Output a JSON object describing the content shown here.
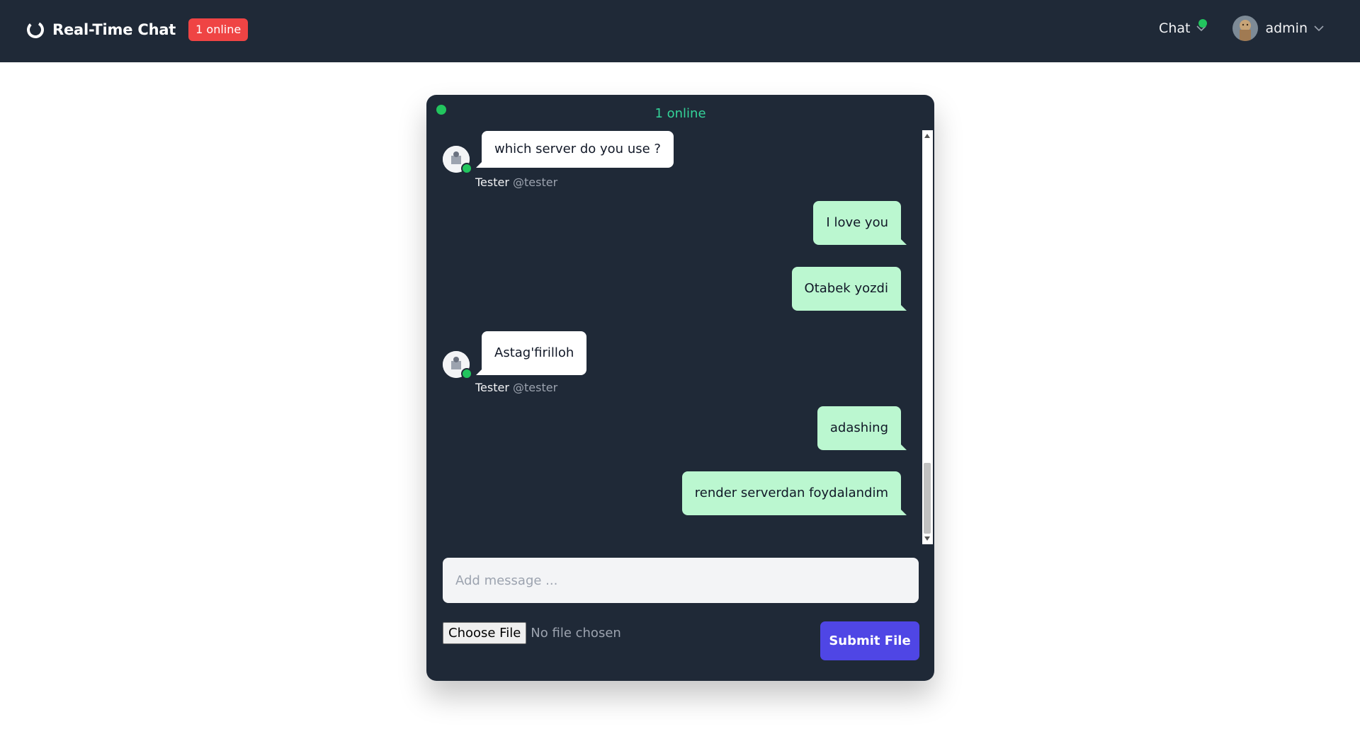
{
  "header": {
    "brand_title": "Real-Time Chat",
    "online_badge": "1 online",
    "nav_chat_label": "Chat",
    "user_name": "admin"
  },
  "chat": {
    "online_status": "1 online",
    "messages": [
      {
        "direction": "incoming",
        "text": "which server do you use ?",
        "author_name": "Tester",
        "author_handle": "@tester"
      },
      {
        "direction": "outgoing",
        "text": "I love you"
      },
      {
        "direction": "outgoing",
        "text": "Otabek yozdi"
      },
      {
        "direction": "incoming",
        "text": "Astag'firilloh",
        "author_name": "Tester",
        "author_handle": "@tester"
      },
      {
        "direction": "outgoing",
        "text": "adashing"
      },
      {
        "direction": "outgoing",
        "text": "render serverdan foydalandim"
      }
    ],
    "input_placeholder": "Add message ...",
    "choose_file_label": "Choose File",
    "file_status": "No file chosen",
    "submit_label": "Submit File"
  },
  "colors": {
    "navbar_bg": "#1f2937",
    "badge_red": "#ef4444",
    "online_green": "#22c55e",
    "outgoing_bubble": "#bbf7d0",
    "submit_button": "#4f46e5"
  },
  "icons": {
    "brand": "loading-ring-icon",
    "chevron": "chevron-down-icon"
  }
}
